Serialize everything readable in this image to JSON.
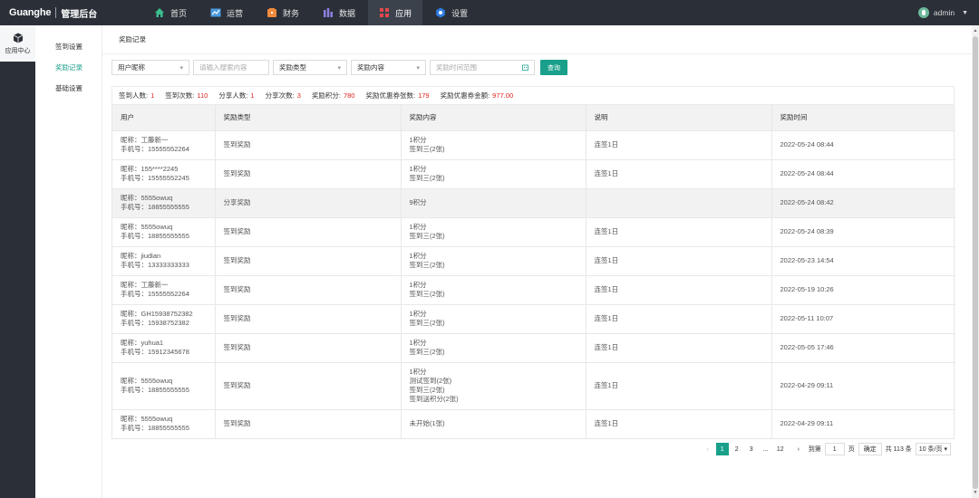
{
  "brand": {
    "name": "Guanghe",
    "subtitle": "管理后台"
  },
  "nav": [
    {
      "label": "首页",
      "icon": "home-icon",
      "color": "#3bbf8e"
    },
    {
      "label": "运营",
      "icon": "chart-icon",
      "color": "#4a9be0"
    },
    {
      "label": "财务",
      "icon": "wallet-icon",
      "color": "#f08a3c"
    },
    {
      "label": "数据",
      "icon": "bars-icon",
      "color": "#8e7fe0"
    },
    {
      "label": "应用",
      "icon": "apps-icon",
      "color": "#e5484d"
    },
    {
      "label": "设置",
      "icon": "gear-icon",
      "color": "#2f7de1"
    }
  ],
  "user": {
    "name": "admin"
  },
  "sidebar": {
    "label": "应用中心"
  },
  "submenu": [
    "签到设置",
    "奖励记录",
    "基础设置"
  ],
  "breadcrumb": "奖励记录",
  "filters": {
    "nickname_select": "用户昵称",
    "search_placeholder": "请输入搜索内容",
    "type_select": "奖励类型",
    "content_select": "奖励内容",
    "date_placeholder": "奖励时间范围",
    "query_button": "查询"
  },
  "stats": [
    {
      "label": "签到人数:",
      "value": "1"
    },
    {
      "label": "签到次数:",
      "value": "110"
    },
    {
      "label": "分享人数:",
      "value": "1"
    },
    {
      "label": "分享次数:",
      "value": "3"
    },
    {
      "label": "奖励积分:",
      "value": "780"
    },
    {
      "label": "奖励优惠券张数:",
      "value": "179"
    },
    {
      "label": "奖励优惠券金额:",
      "value": "977.00"
    }
  ],
  "table": {
    "headers": [
      "用户",
      "奖励类型",
      "奖励内容",
      "说明",
      "奖励时间"
    ],
    "rows": [
      {
        "nick": "昵称：工藤新一",
        "phone": "手机号：15555552264",
        "type": "签到奖励",
        "content": [
          "1积分",
          "签到三(2张)"
        ],
        "note": "连签1日",
        "time": "2022-05-24 08:44"
      },
      {
        "nick": "昵称：155****2245",
        "phone": "手机号：15555552245",
        "type": "签到奖励",
        "content": [
          "1积分",
          "签到三(2张)"
        ],
        "note": "连签1日",
        "time": "2022-05-24 08:44"
      },
      {
        "nick": "昵称：5555owuq",
        "phone": "手机号：18855555555",
        "type": "分享奖励",
        "content": [
          "9积分"
        ],
        "note": "",
        "time": "2022-05-24 08:42"
      },
      {
        "nick": "昵称：5555owuq",
        "phone": "手机号：18855555555",
        "type": "签到奖励",
        "content": [
          "1积分",
          "签到三(2张)"
        ],
        "note": "连签1日",
        "time": "2022-05-24 08:39"
      },
      {
        "nick": "昵称：jiudian",
        "phone": "手机号：13333333333",
        "type": "签到奖励",
        "content": [
          "1积分",
          "签到三(2张)"
        ],
        "note": "连签1日",
        "time": "2022-05-23 14:54"
      },
      {
        "nick": "昵称：工藤新一",
        "phone": "手机号：15555552264",
        "type": "签到奖励",
        "content": [
          "1积分",
          "签到三(2张)"
        ],
        "note": "连签1日",
        "time": "2022-05-19 10:26"
      },
      {
        "nick": "昵称：GH15938752382",
        "phone": "手机号：15938752382",
        "type": "签到奖励",
        "content": [
          "1积分",
          "签到三(2张)"
        ],
        "note": "连签1日",
        "time": "2022-05-11 10:07"
      },
      {
        "nick": "昵称：yuhua1",
        "phone": "手机号：15912345678",
        "type": "签到奖励",
        "content": [
          "1积分",
          "签到三(2张)"
        ],
        "note": "连签1日",
        "time": "2022-05-05 17:46"
      },
      {
        "nick": "昵称：5555owuq",
        "phone": "手机号：18855555555",
        "type": "签到奖励",
        "content": [
          "1积分",
          "测试签到(2张)",
          "签到三(2张)",
          "签到送积分(2张)"
        ],
        "note": "连签1日",
        "time": "2022-04-29 09:11"
      },
      {
        "nick": "昵称：5555owuq",
        "phone": "手机号：18855555555",
        "type": "签到奖励",
        "content": [
          "未开始(1张)"
        ],
        "note": "连签1日",
        "time": "2022-04-29 09:11"
      }
    ]
  },
  "pagination": {
    "prev": "‹",
    "pages": [
      "1",
      "2",
      "3",
      "...",
      "12"
    ],
    "next": "›",
    "goto_label": "到第",
    "goto_value": "1",
    "page_unit": "页",
    "confirm": "确定",
    "total": "共 113 条",
    "page_size": "10 条/页"
  },
  "colors": {
    "accent": "#1aa08a",
    "topbar": "#2b3038",
    "highlight": "#e0261f"
  }
}
